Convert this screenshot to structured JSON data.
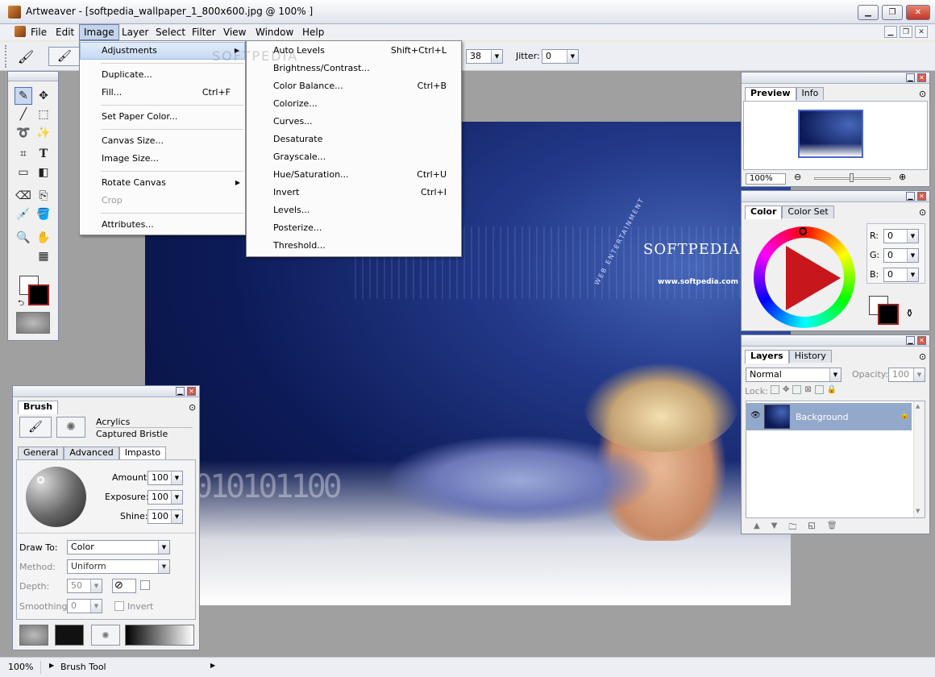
{
  "window": {
    "title": "Artweaver - [softpedia_wallpaper_1_800x600.jpg @ 100% ]"
  },
  "menubar": {
    "items": [
      "File",
      "Edit",
      "Image",
      "Layer",
      "Select",
      "Filter",
      "View",
      "Window",
      "Help"
    ],
    "active": "Image"
  },
  "toolbar": {
    "size_label": ":",
    "size_value": "38",
    "jitter_label": "Jitter:",
    "jitter_value": "0"
  },
  "image_menu": {
    "items": [
      "Adjustments",
      "Duplicate...",
      "Fill...",
      "Set Paper Color...",
      "Canvas Size...",
      "Image Size...",
      "Rotate Canvas",
      "Crop",
      "Attributes..."
    ],
    "fill_shortcut": "Ctrl+F"
  },
  "adjustments_menu": {
    "items": [
      {
        "label": "Auto Levels",
        "shortcut": "Shift+Ctrl+L"
      },
      {
        "label": "Brightness/Contrast...",
        "shortcut": ""
      },
      {
        "label": "Color Balance...",
        "shortcut": "Ctrl+B"
      },
      {
        "label": "Colorize...",
        "shortcut": ""
      },
      {
        "label": "Curves...",
        "shortcut": ""
      },
      {
        "label": "Desaturate",
        "shortcut": ""
      },
      {
        "label": "Grayscale...",
        "shortcut": ""
      },
      {
        "label": "Hue/Saturation...",
        "shortcut": "Ctrl+U"
      },
      {
        "label": "Invert",
        "shortcut": "Ctrl+I"
      },
      {
        "label": "Levels...",
        "shortcut": ""
      },
      {
        "label": "Posterize...",
        "shortcut": ""
      },
      {
        "label": "Threshold...",
        "shortcut": ""
      }
    ]
  },
  "canvas": {
    "brand": "SOFTPEDIA",
    "url": "www.softpedia.com",
    "tagline": "WEB ENTERTAINMENT",
    "watermark": "SOFTPEDIA"
  },
  "preview_panel": {
    "tabs": [
      "Preview",
      "Info"
    ],
    "zoom": "100%"
  },
  "color_panel": {
    "tabs": [
      "Color",
      "Color Set"
    ],
    "r_label": "R:",
    "r": "0",
    "g_label": "G:",
    "g": "0",
    "b_label": "B:",
    "b": "0"
  },
  "layers_panel": {
    "tabs": [
      "Layers",
      "History"
    ],
    "blend_mode": "Normal",
    "opacity_label": "Opacity:",
    "opacity": "100",
    "lock_label": "Lock:",
    "layer_name": "Background"
  },
  "brush_panel": {
    "title": "Brush",
    "category": "Acrylics",
    "variant": "Captured Bristle",
    "tabs": [
      "General",
      "Advanced",
      "Impasto"
    ],
    "amount_label": "Amount:",
    "amount": "100",
    "exposure_label": "Exposure:",
    "exposure": "100",
    "shine_label": "Shine:",
    "shine": "100",
    "draw_to_label": "Draw To:",
    "draw_to": "Color",
    "method_label": "Method:",
    "method": "Uniform",
    "depth_label": "Depth:",
    "depth": "50",
    "smoothing_label": "Smoothing:",
    "smoothing": "0",
    "invert_label": "Invert"
  },
  "statusbar": {
    "zoom": "100%",
    "tool": "Brush Tool"
  },
  "colors": {
    "accent": "#c5d4ec",
    "canvas_bg": "#0c1a57",
    "workspace": "#a0a0a0"
  }
}
